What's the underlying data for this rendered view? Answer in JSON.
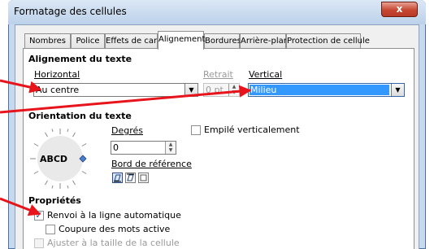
{
  "window": {
    "title": "Formatage des cellules",
    "close_label": "x"
  },
  "tabs": [
    {
      "label": "Nombres",
      "active": false
    },
    {
      "label": "Police",
      "active": false
    },
    {
      "label": "Effets de caractère",
      "active": false
    },
    {
      "label": "Alignement",
      "active": true
    },
    {
      "label": "Bordures",
      "active": false
    },
    {
      "label": "Arrière-plan",
      "active": false
    },
    {
      "label": "Protection de cellule",
      "active": false
    }
  ],
  "text_alignment": {
    "heading": "Alignement du texte",
    "horizontal_label": "Horizontal",
    "horizontal_value": "Au centre",
    "indent_label": "Retrait",
    "indent_value": "0 pt",
    "vertical_label": "Vertical",
    "vertical_value": "Milieu"
  },
  "orientation": {
    "heading": "Orientation du texte",
    "dial_text": "ABCD",
    "degrees_label": "Degrés",
    "degrees_value": "0",
    "reference_edge_label": "Bord de référence",
    "stacked_label": "Empilé verticalement",
    "stacked_checked": false
  },
  "properties": {
    "heading": "Propriétés",
    "wrap_label": "Renvoi à la ligne automatique",
    "wrap_checked": true,
    "hyphenation_label": "Coupure des mots active",
    "hyphenation_checked": false,
    "shrink_label": "Ajuster à la taille de la cellule",
    "shrink_checked": false
  },
  "colors": {
    "arrow": "#e8141b",
    "selection": "#3399ff",
    "close_button": "#c64632"
  }
}
